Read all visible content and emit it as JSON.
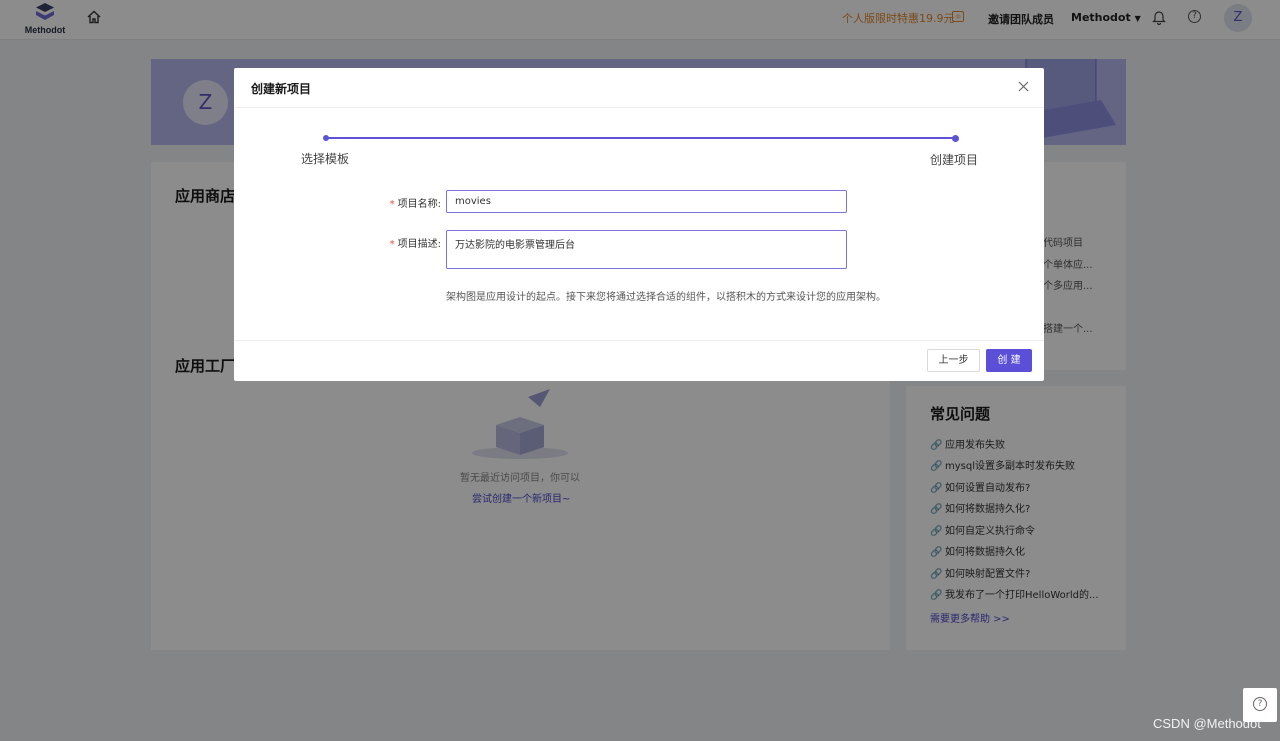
{
  "topbar": {
    "logo_text": "Methodot",
    "promo_text": "个人版限时特惠19.9元",
    "invite_label": "邀请团队成员",
    "user_menu_label": "Methodot",
    "avatar_letter": "Z"
  },
  "banner": {
    "avatar_letter": "Z"
  },
  "sections": {
    "app_store_title": "应用商店",
    "app_factory_title": "应用工厂",
    "faq_title": "常见问题"
  },
  "right_list": [
    "代码项目",
    "个单体应...",
    "个多应用...",
    "",
    "搭建一个..."
  ],
  "empty_state": {
    "text": "暂无最近访问项目，你可以",
    "link": "尝试创建一个新项目~"
  },
  "faq": {
    "items": [
      "应用发布失败",
      "mysql设置多副本时发布失败",
      "如何设置自动发布?",
      "如何将数据持久化?",
      "如何自定义执行命令",
      "如何将数据持久化",
      "如何映射配置文件?",
      "我发布了一个打印HelloWorld的..."
    ],
    "more_link": "需要更多帮助 >>"
  },
  "modal": {
    "title": "创建新项目",
    "steps": [
      "选择模板",
      "创建项目"
    ],
    "name_label": "项目名称:",
    "name_value": "movies",
    "desc_label": "项目描述:",
    "desc_value": "万达影院的电影票管理后台",
    "hint": "架构图是应用设计的起点。接下来您将通过选择合适的组件，以搭积木的方式来设计您的应用架构。",
    "prev_button": "上一步",
    "create_button": "创 建"
  },
  "watermark": "CSDN @Methodot",
  "colors": {
    "accent": "#5b4fd8",
    "promo": "#e0882f"
  }
}
